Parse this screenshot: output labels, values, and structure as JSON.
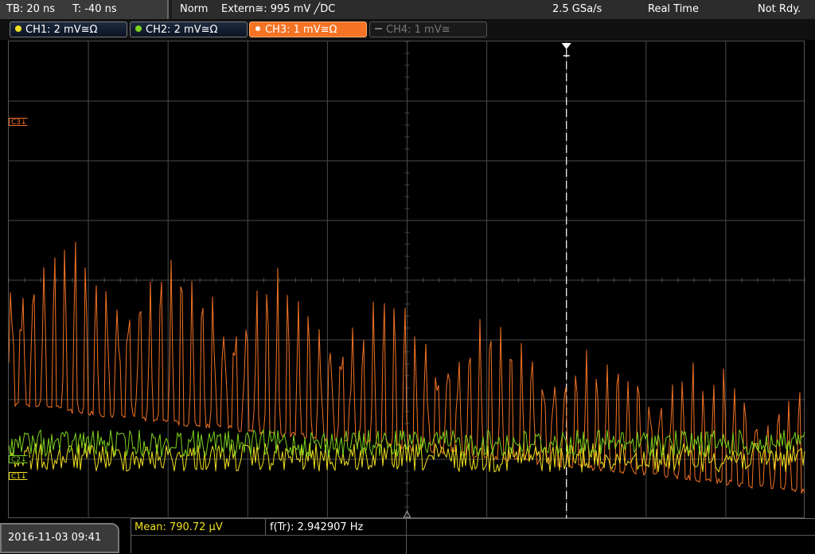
{
  "topbar": {
    "timebase": "TB: 20 ns",
    "trigger_time": "T: -40 ns",
    "mode": "Norm",
    "trigger_source": "Extern≅: 995 mV ╱DC",
    "sample_rate": "2.5 GSa/s",
    "acq_mode": "Real Time",
    "status": "Not Rdy."
  },
  "channels": [
    {
      "label": "CH1: 2 mV≅Ω",
      "color": "#f0e020",
      "active": true
    },
    {
      "label": "CH2: 2 mV≅Ω",
      "color": "#7cd21e",
      "active": true
    },
    {
      "label": "CH3: 1 mV≅Ω",
      "color": "#f47324",
      "active": true,
      "selected": true
    },
    {
      "label": "CH4: 1 mV≅",
      "color": "#777777",
      "active": false
    }
  ],
  "markers": {
    "c3": "C3↓",
    "c2": "C2↓",
    "c1": "C1↓"
  },
  "bottom": {
    "datetime": "2016-11-03 09:41",
    "mean_label": "Mean: 790.72 µV",
    "freq_label": "f(Tr): 2.942907 Hz"
  },
  "colors": {
    "ch1": "#f0e020",
    "ch2": "#7cd21e",
    "ch3": "#f47324",
    "grid": "#4a4a4a"
  }
}
